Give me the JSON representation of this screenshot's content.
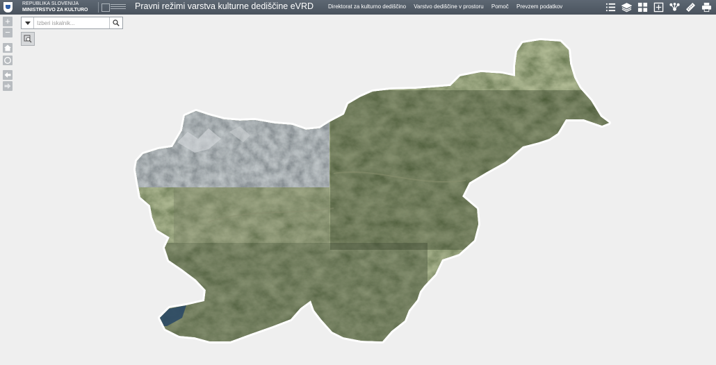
{
  "header": {
    "ministry_line1": "REPUBLIKA SLOVENIJA",
    "ministry_line2": "MINISTRSTVO ZA KULTURO",
    "title": "Pravni režimi varstva kulturne dediščine eVRD",
    "nav": [
      {
        "label": "Direktorat za kulturno dediščino"
      },
      {
        "label": "Varstvo dediščine v prostoru"
      },
      {
        "label": "Pomoč"
      },
      {
        "label": "Prevzem podatkov"
      }
    ],
    "tools": [
      {
        "icon": "legend-list-icon"
      },
      {
        "icon": "layers-icon"
      },
      {
        "icon": "basemap-grid-icon"
      },
      {
        "icon": "add-data-icon"
      },
      {
        "icon": "network-analysis-icon"
      },
      {
        "icon": "measure-ruler-icon"
      },
      {
        "icon": "print-icon"
      }
    ]
  },
  "controls": {
    "zoom_in": "+",
    "zoom_out": "−"
  },
  "search": {
    "placeholder": "Izberi iskalnik..."
  },
  "colors": {
    "header_bg": "#4e5761",
    "sidebar_button": "#b8bcc0",
    "map_background": "#efefef",
    "forest": "#3e4a2e",
    "alpine": "#7b838a"
  }
}
